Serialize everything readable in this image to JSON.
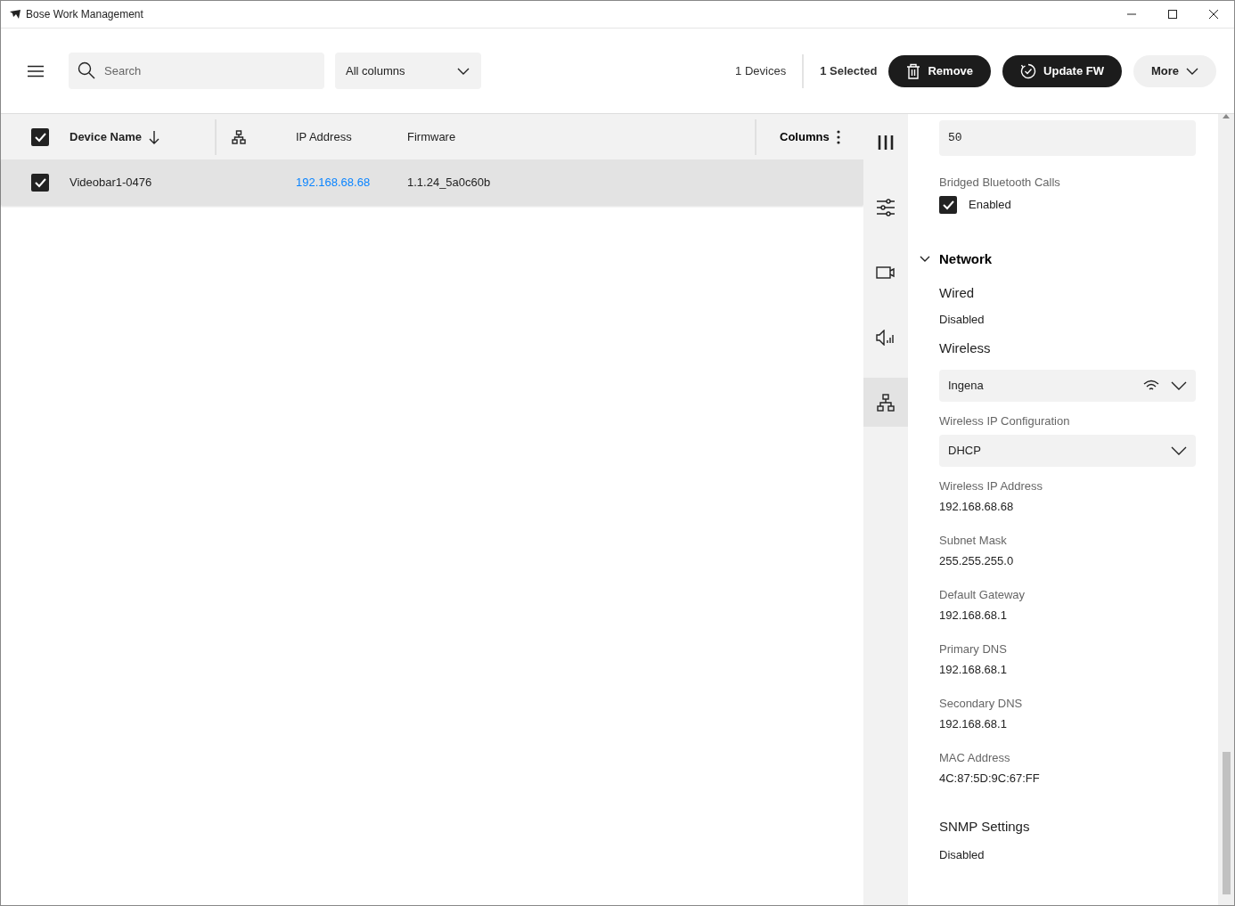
{
  "window": {
    "title": "Bose Work Management"
  },
  "toolbar": {
    "search": {
      "placeholder": "Search"
    },
    "column_filter": {
      "value": "All columns"
    },
    "device_count": "1 Devices",
    "selected_count": "1 Selected",
    "buttons": [
      {
        "label": "Remove",
        "kind": "remove"
      },
      {
        "label": "Update FW",
        "kind": "update"
      },
      {
        "label": "More",
        "kind": "more"
      }
    ]
  },
  "table": {
    "select_all": {
      "checked": true
    },
    "columns": [
      {
        "kind": "name",
        "label": "Device Name"
      },
      {
        "kind": "icon"
      },
      {
        "kind": "text",
        "label": "IP Address"
      },
      {
        "kind": "text",
        "label": "Firmware"
      }
    ],
    "columns_button": "Columns",
    "rows": [
      {
        "checked": true,
        "selected": true,
        "device_name": "Videobar1-0476",
        "ip_address": "192.168.68.68",
        "firmware": "1.1.24_5a0c60b"
      }
    ]
  },
  "rail": {
    "items": [
      {
        "kind": "columns",
        "selected": false
      },
      {
        "kind": "sliders",
        "selected": false
      },
      {
        "kind": "camera",
        "selected": false
      },
      {
        "kind": "speaker",
        "selected": false
      },
      {
        "kind": "network",
        "selected": true
      }
    ]
  },
  "panel": {
    "items": [
      {
        "kind": "input",
        "value": "50"
      },
      {
        "kind": "label",
        "text": "Bridged Bluetooth Calls"
      },
      {
        "kind": "checkbox",
        "label": "Enabled",
        "checked": true
      },
      {
        "kind": "section",
        "title": "Network",
        "expanded": true
      },
      {
        "kind": "subheading",
        "text": "Wired"
      },
      {
        "kind": "value",
        "text": "Disabled"
      },
      {
        "kind": "subheading",
        "text": "Wireless"
      },
      {
        "kind": "select",
        "value": "Ingena",
        "wifi": true
      },
      {
        "kind": "label",
        "text": "Wireless IP Configuration"
      },
      {
        "kind": "select",
        "value": "DHCP",
        "wifi": false
      },
      {
        "kind": "label",
        "text": "Wireless IP Address"
      },
      {
        "kind": "value",
        "text": "192.168.68.68"
      },
      {
        "kind": "label",
        "text": "Subnet Mask"
      },
      {
        "kind": "value",
        "text": "255.255.255.0"
      },
      {
        "kind": "label",
        "text": "Default Gateway"
      },
      {
        "kind": "value",
        "text": "192.168.68.1"
      },
      {
        "kind": "label",
        "text": "Primary DNS"
      },
      {
        "kind": "value",
        "text": "192.168.68.1"
      },
      {
        "kind": "label",
        "text": "Secondary DNS"
      },
      {
        "kind": "value",
        "text": "192.168.68.1"
      },
      {
        "kind": "label",
        "text": "MAC Address"
      },
      {
        "kind": "value",
        "text": "4C:87:5D:9C:67:FF"
      },
      {
        "kind": "subheading",
        "text": "SNMP Settings"
      },
      {
        "kind": "value",
        "text": "Disabled"
      }
    ]
  }
}
